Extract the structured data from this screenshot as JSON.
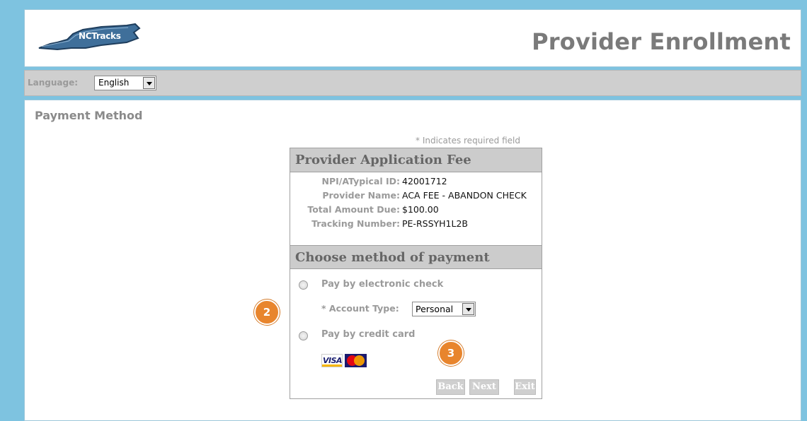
{
  "header": {
    "logo_text": "NCTracks",
    "title": "Provider Enrollment"
  },
  "language": {
    "label": "Language:",
    "selected": "English"
  },
  "page": {
    "title": "Payment Method",
    "required_note": "* Indicates required field"
  },
  "fee_panel": {
    "title": "Provider Application Fee",
    "rows": [
      {
        "label": "NPI/ATypical ID:",
        "value": "42001712"
      },
      {
        "label": "Provider Name:",
        "value": "ACA FEE - ABANDON CHECK"
      },
      {
        "label": "Total Amount Due:",
        "value": "$100.00"
      },
      {
        "label": "Tracking Number:",
        "value": "PE-RSSYH1L2B"
      }
    ]
  },
  "payment": {
    "title": "Choose method of payment",
    "option_echeck": "Pay by electronic check",
    "account_type_label": "* Account Type:",
    "account_type_selected": "Personal",
    "option_credit": "Pay by credit card",
    "card_visa": "VISA",
    "card_mastercard": "MasterCard"
  },
  "buttons": {
    "back": "Back",
    "next": "Next",
    "exit": "Exit"
  },
  "callouts": {
    "two": "2",
    "three": "3"
  },
  "colors": {
    "background": "#7ec3e0",
    "callout": "#e8852d",
    "panel_header": "#cccccc",
    "muted_text": "#9a9a9a"
  }
}
